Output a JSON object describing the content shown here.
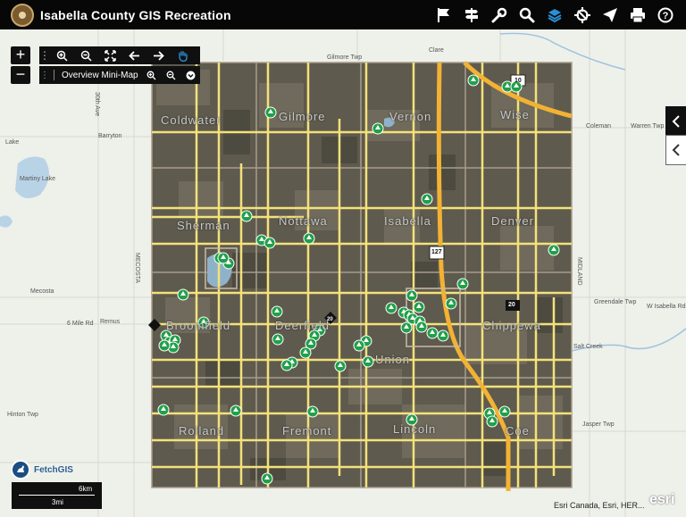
{
  "header": {
    "title": "Isabella County GIS Recreation",
    "toolbar": [
      {
        "icon": "flag-icon",
        "label": "Bookmarks"
      },
      {
        "icon": "signpost-icon",
        "label": "Directions"
      },
      {
        "icon": "wrench-icon",
        "label": "Tools"
      },
      {
        "icon": "search-icon",
        "label": "Search"
      },
      {
        "icon": "layers-icon",
        "label": "Layers"
      },
      {
        "icon": "locate-icon",
        "label": "Locate"
      },
      {
        "icon": "send-icon",
        "label": "Share"
      },
      {
        "icon": "print-icon",
        "label": "Print"
      },
      {
        "icon": "help-icon",
        "label": "Help"
      }
    ],
    "accent": "#2a8fd6"
  },
  "map": {
    "zoom_in": "+",
    "zoom_out": "−",
    "minimap_label": "Overview Mini-Map",
    "fetchgis": "FetchGIS",
    "scale": {
      "km": "6km",
      "mi": "3mi"
    },
    "attribution": "Esri Canada, Esri, HER...",
    "esri": "esri",
    "township_labels": [
      "Coldwater",
      "Gilmore",
      "Vernon",
      "Wise",
      "Sherman",
      "Nottawa",
      "Isabella",
      "Denver",
      "Broomfield",
      "Deerfield",
      "Union",
      "Chippewa",
      "Rolland",
      "Fremont",
      "Lincoln",
      "Coe"
    ],
    "place_labels": [
      "Gilmore Twp",
      "Clare",
      "Barryton",
      "Lake",
      "Martiny Lake",
      "Mecosta",
      "Remus",
      "6 Mile Rd",
      "Hinton Twp",
      "Coleman",
      "Warren Twp",
      "Greendale Twp",
      "Salt Creek",
      "W Isabella Rd",
      "Jasper Twp",
      "MECOSTA",
      "MIDLAND",
      "30th Ave"
    ],
    "route_shields": [
      "10",
      "127",
      "20",
      "20"
    ],
    "park_marker_count": 58
  }
}
